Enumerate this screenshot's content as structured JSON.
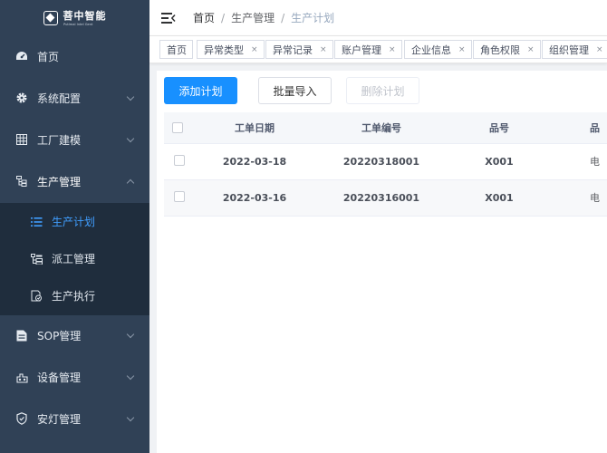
{
  "logo": {
    "title": "菩中智能",
    "subtitle": "Putlmal Intel Gent"
  },
  "sidebar": {
    "items": [
      {
        "label": "首页",
        "icon": "dashboard-icon"
      },
      {
        "label": "系统配置",
        "icon": "gear-icon"
      },
      {
        "label": "工厂建模",
        "icon": "grid-icon"
      },
      {
        "label": "生产管理",
        "icon": "tree-icon",
        "open": true
      },
      {
        "label": "SOP管理",
        "icon": "document-icon"
      },
      {
        "label": "设备管理",
        "icon": "device-icon"
      },
      {
        "label": "安灯管理",
        "icon": "shield-icon"
      }
    ],
    "subitems": [
      {
        "label": "生产计划",
        "icon": "list-icon",
        "active": true
      },
      {
        "label": "派工管理",
        "icon": "assign-icon"
      },
      {
        "label": "生产执行",
        "icon": "execute-icon"
      }
    ]
  },
  "breadcrumb": {
    "home": "首页",
    "middle": "生产管理",
    "current": "生产计划",
    "separator": "/"
  },
  "tags": [
    "首页",
    "异常类型",
    "异常记录",
    "账户管理",
    "企业信息",
    "角色权限",
    "组织管理"
  ],
  "tag_close": "×",
  "toolbar": {
    "add_label": "添加计划",
    "import_label": "批量导入",
    "delete_label": "删除计划"
  },
  "table": {
    "headers": {
      "date": "工单日期",
      "order_no": "工单编号",
      "part_no": "品号",
      "part_name": "品"
    },
    "rows": [
      {
        "date": "2022-03-18",
        "order_no": "20220318001",
        "part_no": "X001",
        "part_name": "电"
      },
      {
        "date": "2022-03-16",
        "order_no": "20220316001",
        "part_no": "X001",
        "part_name": "电"
      }
    ]
  },
  "colors": {
    "sidebar_bg": "#304156",
    "submenu_bg": "#1f2d3d",
    "accent": "#1890ff",
    "active_text": "#409eff"
  }
}
